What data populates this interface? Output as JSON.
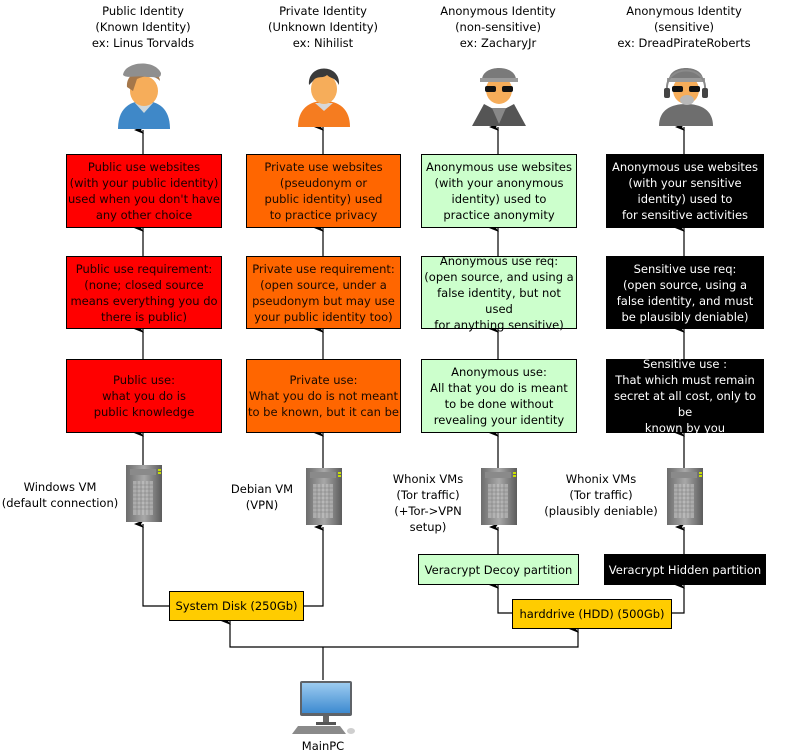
{
  "identities": [
    {
      "title": "Public Identity\n(Known Identity)\nex: Linus Torvalds",
      "avatar": "user-cap-blue-hoodie-icon"
    },
    {
      "title": "Private Identity\n(Unknown Identity)\nex: Nihilist",
      "avatar": "user-orange-hoodie-icon"
    },
    {
      "title": "Anonymous Identity\n(non-sensitive)\nex: ZacharyJr",
      "avatar": "spy-trenchcoat-icon"
    },
    {
      "title": "Anonymous Identity\n(sensitive)\nex: DreadPirateRoberts",
      "avatar": "spy-headset-icon"
    }
  ],
  "websites": [
    "Public use websites\n(with your public identity)\nused when you don't have\nany other choice",
    "Private use websites\n(pseudonym or\npublic identity) used\nto practice privacy",
    "Anonymous use websites\n(with your anonymous\nidentity) used to\npractice anonymity",
    "Anonymous use websites\n(with your sensitive\nidentity) used to\nfor sensitive activities"
  ],
  "requirements": [
    "Public use requirement:\n(none; closed source\nmeans everything you do\nthere is public)",
    "Private use requirement:\n(open source, under a\npseudonym but may use\nyour public identity too)",
    "Anonymous use req:\n(open source, and using a\nfalse identity, but not used\nfor anything sensitive)",
    "Sensitive use req:\n(open source, using a\nfalse identity, and must\nbe plausibly deniable)"
  ],
  "uses": [
    "Public use:\nwhat you do is\npublic knowledge",
    "Private use:\nWhat you do is not meant\nto be known, but it can be",
    "Anonymous use:\nAll that you do is meant\nto be done without\nrevealing your identity",
    "Sensitive use :\nThat which must remain\nsecret at all cost, only to be\nknown by you"
  ],
  "vms": [
    "Windows VM\n(default connection)",
    "Debian VM\n(VPN)",
    "Whonix VMs\n(Tor traffic)\n(+Tor->VPN setup)",
    "Whonix VMs\n(Tor traffic)\n(plausibly deniable)"
  ],
  "partitions": {
    "decoy": "Veracrypt Decoy partition",
    "hidden": "Veracrypt Hidden partition"
  },
  "disks": {
    "system": "System Disk (250Gb)",
    "hdd": "harddrive (HDD) (500Gb)"
  },
  "pc": {
    "label": "MainPC"
  },
  "colors": {
    "public": "#ff0000",
    "private": "#ff6600",
    "anonymous": "#ccffcc",
    "sensitive": "#000000",
    "disk": "#ffcc00"
  }
}
